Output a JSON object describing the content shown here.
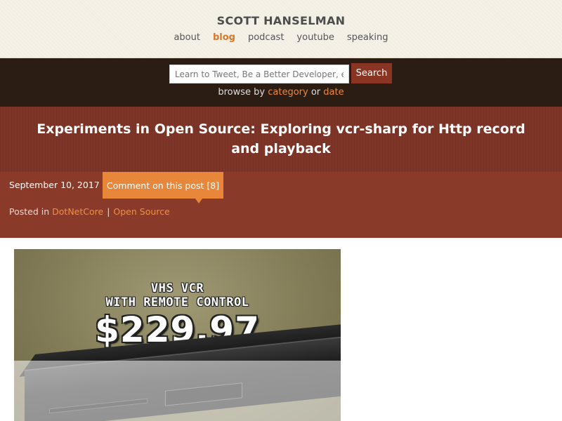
{
  "header": {
    "site_title": "SCOTT HANSELMAN",
    "nav": [
      {
        "label": "about",
        "active": false
      },
      {
        "label": "blog",
        "active": true
      },
      {
        "label": "podcast",
        "active": false
      },
      {
        "label": "youtube",
        "active": false
      },
      {
        "label": "speaking",
        "active": false
      }
    ]
  },
  "search": {
    "placeholder": "Learn to Tweet, Be a Better Developer, e",
    "button_label": "Search",
    "browse_prefix": "browse by",
    "browse_category": "category",
    "browse_or": "or",
    "browse_date": "date"
  },
  "post": {
    "title": "Experiments in Open Source: Exploring vcr-sharp for Http record and playback",
    "date": "September 10, 2017",
    "comment_link": "Comment on this post [8]",
    "posted_in_label": "Posted in",
    "categories": [
      "DotNetCore",
      "Open Source"
    ],
    "separator": "|"
  },
  "image": {
    "line1": "VHS VCR",
    "line2": "WITH REMOTE CONTROL",
    "price": "$229.97"
  },
  "colors": {
    "accent": "#e8873a",
    "header_bg": "#f5f1e6",
    "search_bar_bg": "#2c1d14",
    "title_band_bg": "#7e3427",
    "meta_band_bg": "#8a3a29",
    "search_button": "#8a3424"
  }
}
